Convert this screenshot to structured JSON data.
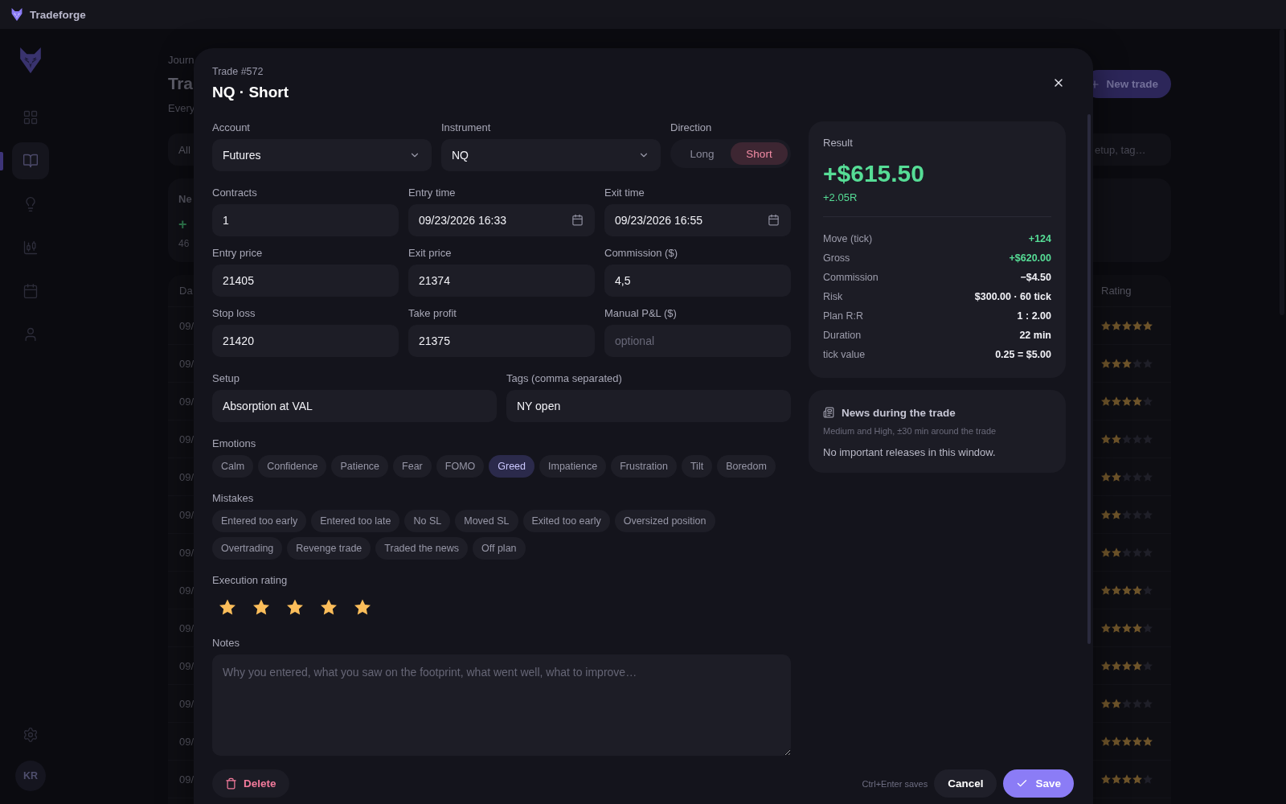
{
  "titlebar": {
    "app_name": "Tradeforge"
  },
  "sidebar": {
    "nav_items": [
      {
        "selected": false
      },
      {
        "selected": true
      },
      {
        "selected": false
      },
      {
        "selected": false
      },
      {
        "selected": false
      },
      {
        "selected": false
      }
    ],
    "avatar": "KR"
  },
  "page": {
    "breadcrumb": "Journ",
    "title": "Tra",
    "subtitle": "Every",
    "new_trade_button": "New trade",
    "filter_tab": "All",
    "search_placeholder": "etup, tag…",
    "stat_card": {
      "label": "Ne",
      "value": "+",
      "note": "46"
    },
    "table": {
      "columns": [
        "Da",
        "Rating"
      ],
      "rows": [
        {
          "column_1": "09/",
          "stars": 5
        },
        {
          "column_1": "09/",
          "stars": 3
        },
        {
          "column_1": "09/",
          "stars": 4
        },
        {
          "column_1": "09/",
          "stars": 2
        },
        {
          "column_1": "09/",
          "stars": 2
        },
        {
          "column_1": "09/",
          "stars": 2
        },
        {
          "column_1": "09/",
          "stars": 2
        },
        {
          "column_1": "09/",
          "stars": 4
        },
        {
          "column_1": "09/",
          "stars": 4
        },
        {
          "column_1": "09/",
          "stars": 4
        },
        {
          "column_1": "09/",
          "stars": 2
        },
        {
          "column_1": "09/",
          "stars": 5
        },
        {
          "column_1": "09/",
          "stars": 4
        }
      ]
    }
  },
  "dialog": {
    "caption": "Trade #572",
    "title": "NQ · Short",
    "form_rows": [
      {
        "fields": [
          {
            "kind": "select",
            "label": "Account",
            "value": "Futures"
          },
          {
            "kind": "select",
            "label": "Instrument",
            "value": "NQ"
          },
          {
            "kind": "toggle",
            "label": "Direction",
            "options": [
              {
                "label": "Long",
                "selected": false
              },
              {
                "label": "Short",
                "selected": true
              }
            ]
          }
        ]
      },
      {
        "fields": [
          {
            "kind": "text",
            "label": "Contracts",
            "value": "1"
          },
          {
            "kind": "datetime",
            "label": "Entry time",
            "value": "09/23/2026 16:33"
          },
          {
            "kind": "datetime",
            "label": "Exit time",
            "value": "09/23/2026 16:55"
          }
        ]
      },
      {
        "fields": [
          {
            "kind": "text",
            "label": "Entry price",
            "value": "21405"
          },
          {
            "kind": "text",
            "label": "Exit price",
            "value": "21374"
          },
          {
            "kind": "text",
            "label": "Commission ($)",
            "value": "4,5"
          }
        ]
      },
      {
        "fields": [
          {
            "kind": "text",
            "label": "Stop loss",
            "value": "21420"
          },
          {
            "kind": "text",
            "label": "Take profit",
            "value": "21375"
          },
          {
            "kind": "text",
            "label": "Manual P&L ($)",
            "placeholder": "optional"
          }
        ]
      },
      {
        "fields": [
          {
            "kind": "text",
            "label": "Setup",
            "value": "Absorption at VAL"
          },
          {
            "kind": "text",
            "label": "Tags (comma separated)",
            "value": "NY open"
          }
        ]
      }
    ],
    "emotions": {
      "label": "Emotions",
      "items": [
        {
          "label": "Calm",
          "selected": false
        },
        {
          "label": "Confidence",
          "selected": false
        },
        {
          "label": "Patience",
          "selected": false
        },
        {
          "label": "Fear",
          "selected": false
        },
        {
          "label": "FOMO",
          "selected": false
        },
        {
          "label": "Greed",
          "selected": true
        },
        {
          "label": "Impatience",
          "selected": false
        },
        {
          "label": "Frustration",
          "selected": false
        },
        {
          "label": "Tilt",
          "selected": false
        },
        {
          "label": "Boredom",
          "selected": false
        }
      ]
    },
    "mistakes": {
      "label": "Mistakes",
      "items": [
        {
          "label": "Entered too early",
          "selected": false
        },
        {
          "label": "Entered too late",
          "selected": false
        },
        {
          "label": "No SL",
          "selected": false
        },
        {
          "label": "Moved SL",
          "selected": false
        },
        {
          "label": "Exited too early",
          "selected": false
        },
        {
          "label": "Oversized position",
          "selected": false
        },
        {
          "label": "Overtrading",
          "selected": false
        },
        {
          "label": "Revenge trade",
          "selected": false
        },
        {
          "label": "Traded the news",
          "selected": false
        },
        {
          "label": "Off plan",
          "selected": false
        }
      ]
    },
    "execution_rating": {
      "label": "Execution rating",
      "stars": 5
    },
    "notes": {
      "label": "Notes",
      "placeholder": "Why you entered, what you saw on the footprint, what went well, what to improve…"
    },
    "result": {
      "label": "Result",
      "pnl": "+$615.50",
      "r_multiple": "+2.05R",
      "rows": [
        {
          "label": "Move (tick)",
          "value": "+124",
          "kind": "positive"
        },
        {
          "label": "Gross",
          "value": "+$620.00",
          "kind": "positive"
        },
        {
          "label": "Commission",
          "value": "−$4.50",
          "kind": "plain"
        },
        {
          "label": "Risk",
          "value": "$300.00 · 60 tick",
          "kind": "plain"
        },
        {
          "label": "Plan R:R",
          "value": "1 : 2.00",
          "kind": "plain"
        },
        {
          "label": "Duration",
          "value": "22 min",
          "kind": "plain"
        },
        {
          "label": "tick value",
          "value": "0.25 = $5.00",
          "kind": "plain"
        }
      ]
    },
    "news": {
      "title": "News during the trade",
      "subtitle": "Medium and High, ±30 min around the trade",
      "message": "No important releases in this window."
    },
    "footer": {
      "delete_button": "Delete",
      "hint": "Ctrl+Enter saves",
      "cancel_button": "Cancel",
      "save_button": "Save"
    }
  }
}
